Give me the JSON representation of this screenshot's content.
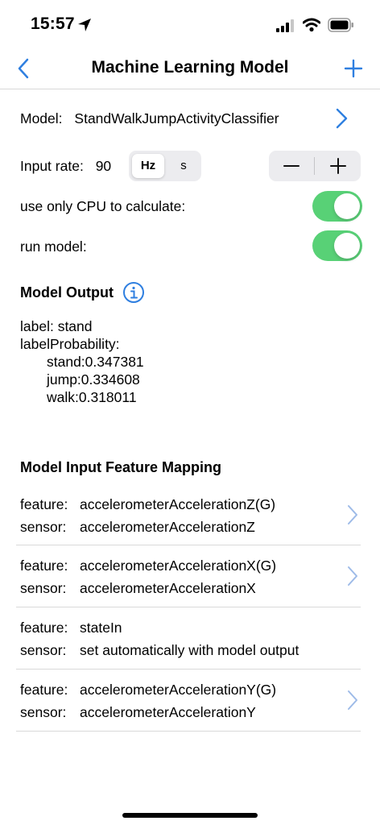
{
  "status": {
    "time": "15:57"
  },
  "nav": {
    "title": "Machine Learning Model"
  },
  "model": {
    "label": "Model:",
    "name": "StandWalkJumpActivityClassifier"
  },
  "input_rate": {
    "label": "Input rate:",
    "value": "90",
    "units": [
      "Hz",
      "s"
    ],
    "selected_unit": "Hz",
    "minus": "−",
    "plus": "+"
  },
  "settings": {
    "cpu_only_label": "use only CPU to calculate:",
    "cpu_only_on": true,
    "run_model_label": "run model:",
    "run_model_on": true
  },
  "output": {
    "header": "Model Output",
    "label_line": "label: stand",
    "prob_header": "labelProbability:",
    "probabilities": [
      "stand:0.347381",
      "jump:0.334608",
      "walk:0.318011"
    ]
  },
  "mapping": {
    "header": "Model Input Feature Mapping",
    "feature_key": "feature:",
    "sensor_key": "sensor:",
    "rows": [
      {
        "feature": "accelerometerAccelerationZ(G)",
        "sensor": "accelerometerAccelerationZ"
      },
      {
        "feature": "accelerometerAccelerationX(G)",
        "sensor": "accelerometerAccelerationX"
      },
      {
        "feature": "stateIn",
        "sensor": "set automatically with model output"
      },
      {
        "feature": "accelerometerAccelerationY(G)",
        "sensor": "accelerometerAccelerationY"
      }
    ]
  },
  "colors": {
    "accent": "#2f7fe0",
    "toggle_on": "#34c759",
    "chevron": "#9ebbe8"
  }
}
